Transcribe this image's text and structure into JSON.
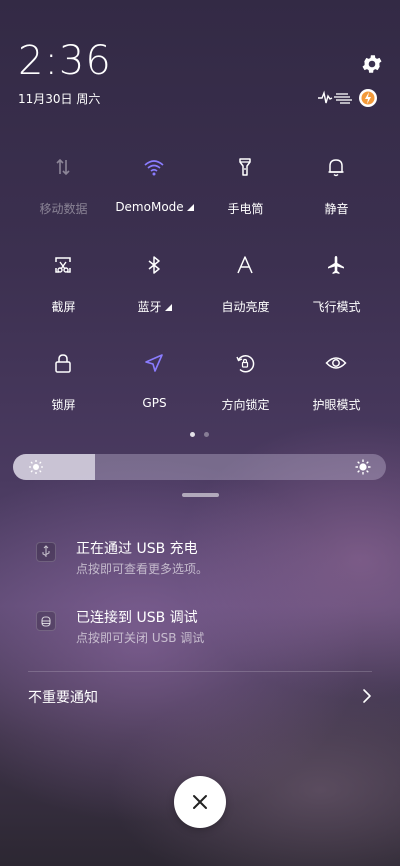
{
  "status": {
    "time": "2:36",
    "date": "11月30日 周六",
    "icons": [
      "signal-wave-icon",
      "speed-lines-icon",
      "battery-charging-icon"
    ]
  },
  "settings_icon": "gear-icon",
  "quick_tiles": [
    {
      "label": "移动数据",
      "icon": "mobile-data-icon",
      "active": false
    },
    {
      "label": "DemoMode",
      "icon": "wifi-icon",
      "active": true,
      "has_submenu": true
    },
    {
      "label": "手电筒",
      "icon": "flashlight-icon",
      "active": false
    },
    {
      "label": "静音",
      "icon": "bell-icon",
      "active": false
    },
    {
      "label": "截屏",
      "icon": "screenshot-scissors-icon",
      "active": false
    },
    {
      "label": "蓝牙",
      "icon": "bluetooth-icon",
      "active": false,
      "has_submenu": true
    },
    {
      "label": "自动亮度",
      "icon": "auto-brightness-icon",
      "active": false
    },
    {
      "label": "飞行模式",
      "icon": "airplane-icon",
      "active": false
    },
    {
      "label": "锁屏",
      "icon": "lock-icon",
      "active": false
    },
    {
      "label": "GPS",
      "icon": "location-arrow-icon",
      "active": true
    },
    {
      "label": "方向锁定",
      "icon": "rotation-lock-icon",
      "active": false
    },
    {
      "label": "护眼模式",
      "icon": "eye-icon",
      "active": false
    }
  ],
  "page_indicator": {
    "pages": 2,
    "current": 1
  },
  "brightness": {
    "level": 0.22,
    "low_icon": "sun-small-icon",
    "high_icon": "sun-large-icon"
  },
  "notifications": [
    {
      "title": "正在通过 USB 充电",
      "subtitle": "点按即可查看更多选项。",
      "icon": "usb-icon"
    },
    {
      "title": "已连接到 USB 调试",
      "subtitle": "点按即可关闭 USB 调试",
      "icon": "debug-bug-icon"
    }
  ],
  "unimportant": {
    "label": "不重要通知",
    "icon": "chevron-right-icon"
  },
  "close_button": {
    "icon": "close-icon"
  },
  "colors": {
    "accent": "#7b6cff",
    "active_icon": "#8a7cff",
    "dim": "#7e7690"
  }
}
